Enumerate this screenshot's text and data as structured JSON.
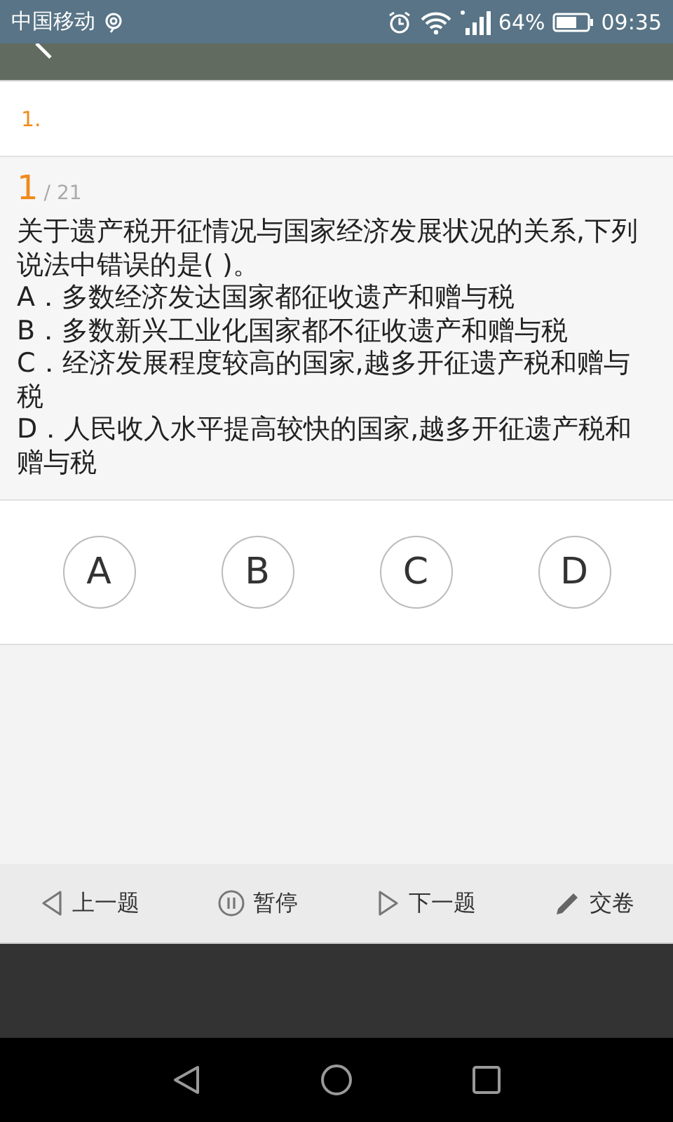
{
  "status_bar": {
    "carrier": "中国移动",
    "battery": "64%",
    "time": "09:35"
  },
  "answer_sheet": {
    "label": "1."
  },
  "question": {
    "number": "1",
    "total": "/ 21",
    "text": "关于遗产税开征情况与国家经济发展状况的关系,下列说法中错误的是(   )。",
    "options": [
      "A．多数经济发达国家都征收遗产和赠与税",
      "B．多数新兴工业化国家都不征收遗产和赠与税",
      "C．经济发展程度较高的国家,越多开征遗产税和赠与税",
      "D．人民收入水平提高较快的国家,越多开征遗产税和赠与税"
    ]
  },
  "choices": [
    {
      "label": "A",
      "selected": false
    },
    {
      "label": "B",
      "selected": false
    },
    {
      "label": "C",
      "selected": false
    },
    {
      "label": "D",
      "selected": false
    }
  ],
  "toolbar": [
    {
      "kind": "prev",
      "label": "上一题"
    },
    {
      "kind": "pause",
      "label": "暂停"
    },
    {
      "kind": "next",
      "label": "下一题"
    },
    {
      "kind": "submit",
      "label": "交卷"
    }
  ]
}
